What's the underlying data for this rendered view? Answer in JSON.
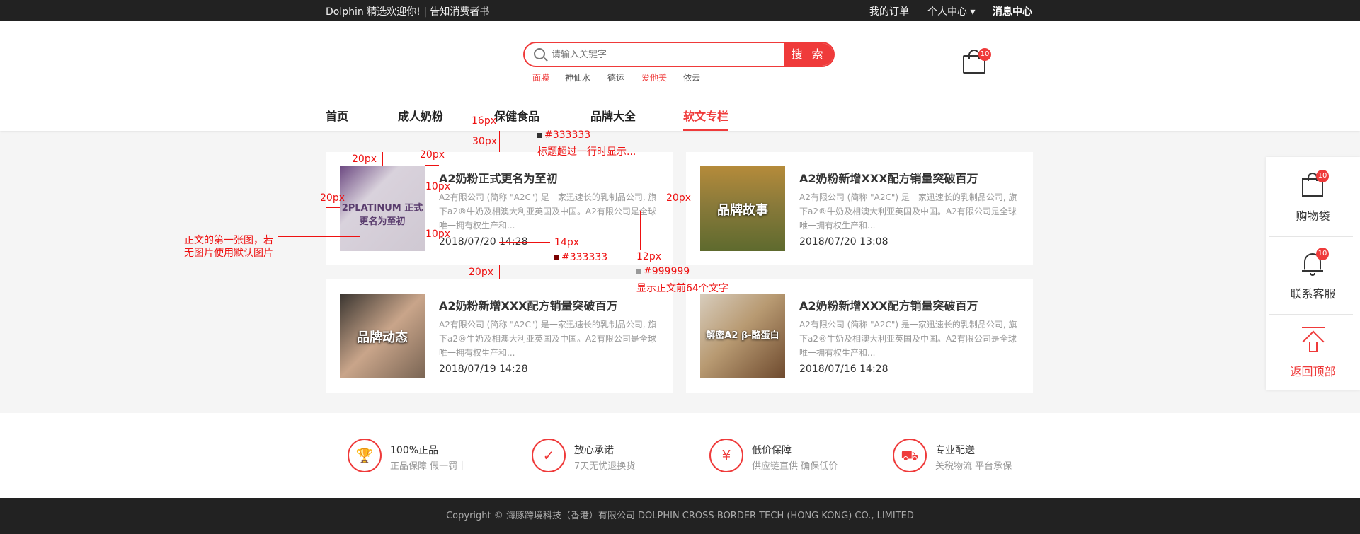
{
  "topbar": {
    "welcome": "Dolphin 精选欢迎你! | 告知消费者书",
    "links": [
      "我的订单",
      "个人中心 ▾",
      "消息中心"
    ]
  },
  "search": {
    "placeholder": "请输入关键字",
    "button": "搜 索",
    "hot": [
      {
        "text": "面膜",
        "highlight": true
      },
      {
        "text": "神仙水",
        "highlight": false
      },
      {
        "text": "德运",
        "highlight": false
      },
      {
        "text": "爱他美",
        "highlight": true
      },
      {
        "text": "依云",
        "highlight": false
      }
    ]
  },
  "cart": {
    "count": "10"
  },
  "nav": [
    "首页",
    "成人奶粉",
    "保健食品",
    "品牌大全",
    "软文专栏"
  ],
  "articles": [
    {
      "title": "A2奶粉正式更名为至初",
      "excerpt": "A2有限公司 (简称 \"A2C\") 是一家迅速长的乳制品公司, 旗下a2®牛奶及相澳大利亚英国及中国。A2有限公司是全球唯一拥有权生产和...",
      "date": "2018/07/20 14:28",
      "thumb_text": "2PLATINUM 正式更名为至初",
      "thumb_color": "#5a3d6e"
    },
    {
      "title": "A2奶粉新增XXX配方销量突破百万",
      "excerpt": "A2有限公司 (简称 \"A2C\") 是一家迅速长的乳制品公司, 旗下a2®牛奶及相澳大利亚英国及中国。A2有限公司是全球唯一拥有权生产和...",
      "date": "2018/07/20 13:08",
      "thumb_text": "品牌故事",
      "thumb_color": "#6b6a3a"
    },
    {
      "title": "A2奶粉新增XXX配方销量突破百万",
      "excerpt": "A2有限公司 (简称 \"A2C\") 是一家迅速长的乳制品公司, 旗下a2®牛奶及相澳大利亚英国及中国。A2有限公司是全球唯一拥有权生产和...",
      "date": "2018/07/19 14:28",
      "thumb_text": "品牌动态",
      "thumb_color": "#7a6554"
    },
    {
      "title": "A2奶粉新增XXX配方销量突破百万",
      "excerpt": "A2有限公司 (简称 \"A2C\") 是一家迅速长的乳制品公司, 旗下a2®牛奶及相澳大利亚英国及中国。A2有限公司是全球唯一拥有权生产和...",
      "date": "2018/07/16 14:28",
      "thumb_text": "解密A2 β-酪蛋白",
      "thumb_color": "#8a6a4a"
    }
  ],
  "sidebar": {
    "cart_label": "购物袋",
    "cart_count": "10",
    "service_label": "联系客服",
    "service_count": "10",
    "top_label": "返回顶部"
  },
  "features": [
    {
      "icon": "trophy-icon",
      "glyph": "🏆",
      "title": "100%正品",
      "sub": "正品保障  假一罚十"
    },
    {
      "icon": "shield-icon",
      "glyph": "✓",
      "title": "放心承诺",
      "sub": "7天无忧退换货"
    },
    {
      "icon": "yen-icon",
      "glyph": "¥",
      "title": "低价保障",
      "sub": "供应链直供  确保低价"
    },
    {
      "icon": "truck-icon",
      "glyph": "⛟",
      "title": "专业配送",
      "sub": "关税物流 平台承保"
    }
  ],
  "copyright": "Copyright ©  海豚跨境科技（香港）有限公司    DOLPHIN CROSS-BORDER TECH (HONG KONG) CO., LIMITED",
  "annotations": {
    "gap30": "30px",
    "font16": "16px",
    "color333": "#333333",
    "title_note": "标题超过一行时显示...",
    "gap20a": "20px",
    "gap20b": "20px",
    "gap20c": "20px",
    "gap10a": "10px",
    "gap10b": "10px",
    "img_note_1": "正文的第一张图，若",
    "img_note_2": "无图片使用默认图片",
    "font14": "14px",
    "color333b": "#333333",
    "font12": "12px",
    "color999": "#999999",
    "excerpt_note": "显示正文前64个文字",
    "gap20d": "20px",
    "gap20e": "20px"
  }
}
